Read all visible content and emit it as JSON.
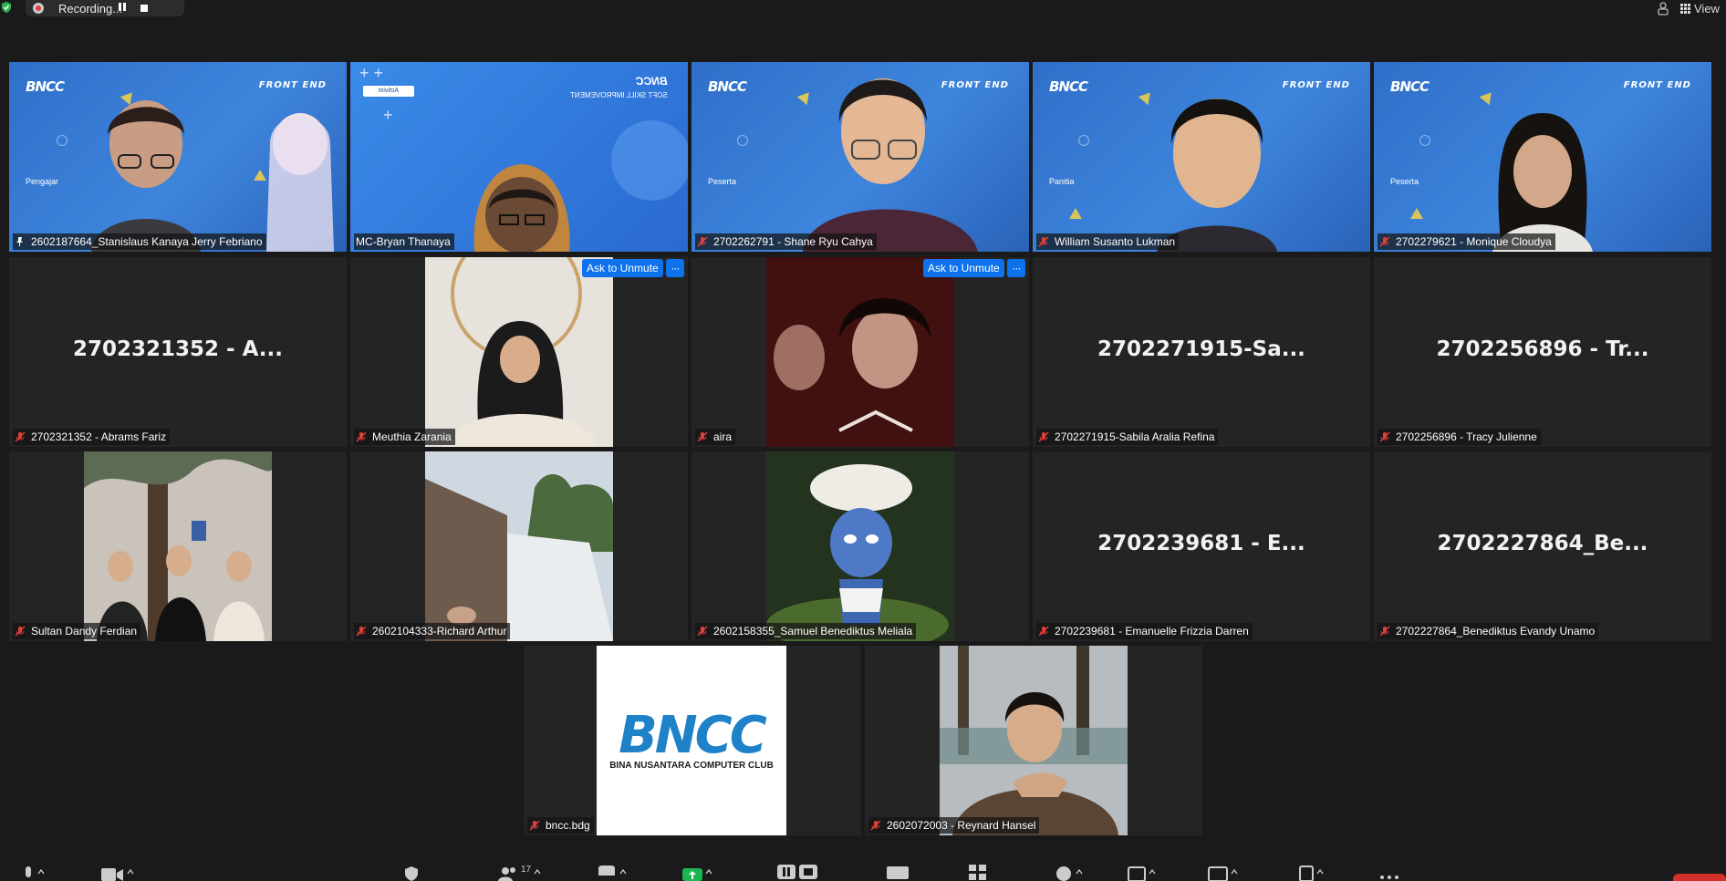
{
  "top_bar": {
    "recording_label": "Recording...",
    "view_label": "View"
  },
  "tiles": [
    {
      "display_name": "2602187664_Stanislaus Kanaya Jerry Febriano",
      "video": "bncc-frontend",
      "role": "Pengajar",
      "pinned": true,
      "active_speaker": true
    },
    {
      "display_name": "MC-Bryan Thanaya",
      "video": "soft-skill",
      "banner_brand": "BNCC",
      "banner_text": "SOFT SKILL IMPROVEMENT",
      "badge": "Activist",
      "muted": false
    },
    {
      "display_name": "2702262791 - Shane Ryu Cahya",
      "video": "bncc-frontend",
      "role": "Peserta",
      "muted": true
    },
    {
      "display_name": "William Susanto Lukman",
      "video": "bncc-frontend",
      "role": "Panitia",
      "muted": true
    },
    {
      "display_name": "2702279621 - Monique Cloudya",
      "video": "bncc-frontend",
      "role": "Peserta",
      "muted": true
    },
    {
      "display_name": "2702321352 - Abrams Fariz",
      "placeholder_name": "2702321352 - A...",
      "muted": true
    },
    {
      "display_name": "Meuthia Zarania",
      "video": "photo",
      "ask_to_unmute": "Ask to Unmute",
      "muted": true
    },
    {
      "display_name": "aira",
      "video": "photo",
      "ask_to_unmute": "Ask to Unmute",
      "muted": true
    },
    {
      "display_name": "2702271915-Sabila Aralia Refina",
      "placeholder_name": "2702271915-Sa...",
      "muted": true
    },
    {
      "display_name": "2702256896 - Tracy Julienne",
      "placeholder_name": "2702256896 - Tr...",
      "muted": true
    },
    {
      "display_name": "Sultan Dandy Ferdian",
      "video": "photo",
      "muted": true
    },
    {
      "display_name": "2602104333-Richard Arthur",
      "video": "photo",
      "muted": true
    },
    {
      "display_name": "2602158355_Samuel Benediktus Meliala",
      "video": "photo",
      "muted": true
    },
    {
      "display_name": "2702239681 - Emanuelle Frizzia Darren",
      "placeholder_name": "2702239681 - E...",
      "muted": true
    },
    {
      "display_name": "2702227864_Benediktus Evandy Unamo",
      "placeholder_name": "2702227864_Be...",
      "muted": true
    },
    {
      "display_name": "bncc.bdg",
      "video": "bncc-logo",
      "logo_text": "BNCC",
      "logo_subtitle": "BINA NUSANTARA COMPUTER CLUB",
      "muted": true
    },
    {
      "display_name": "2602072003 - Reynard Hansel",
      "video": "photo",
      "muted": true
    }
  ],
  "video_banner": {
    "brand": "BNCC",
    "track": "FRONT END"
  },
  "toolbar": {
    "participants_count": "17",
    "icons": [
      "microphone-icon",
      "camera-icon",
      "security-icon",
      "participants-icon",
      "chat-icon",
      "share-screen-icon",
      "pause-share-icon",
      "captions-icon",
      "apps-icon",
      "reactions-icon",
      "whiteboard-icon",
      "rooms-icon",
      "notes-icon",
      "more-icon"
    ],
    "end_color": "#d3302a"
  },
  "colors": {
    "background": "#1a1a1a",
    "tile": "#242424",
    "active_outline": "#e6e05b",
    "button_blue": "#0e72ed",
    "muted_red": "#e0403a"
  }
}
